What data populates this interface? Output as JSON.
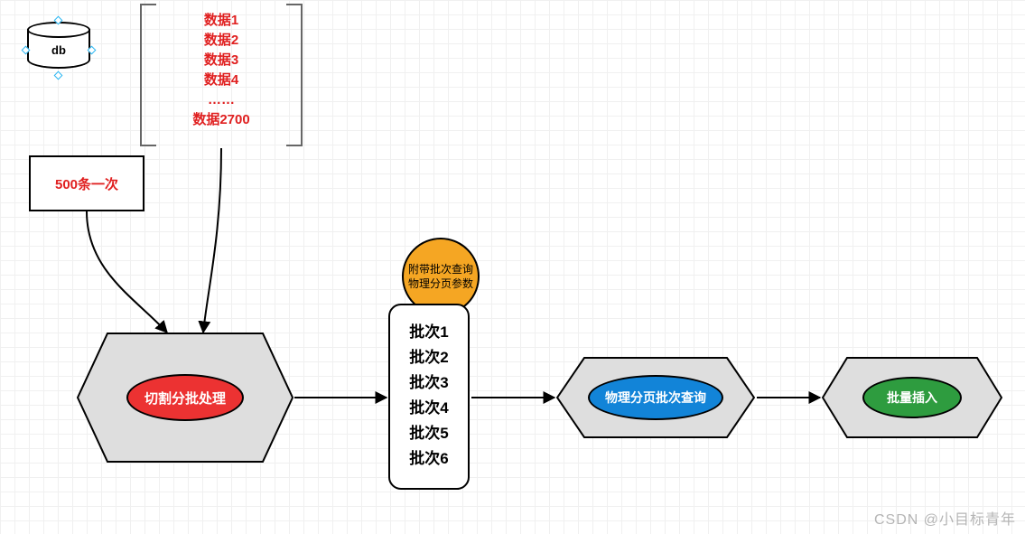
{
  "db": {
    "label": "db"
  },
  "datalist": {
    "items": [
      "数据1",
      "数据2",
      "数据3",
      "数据4",
      "……",
      "数据2700"
    ]
  },
  "box500": {
    "label": "500条一次"
  },
  "hex_split": {
    "label": "切割分批处理"
  },
  "circle_orange": {
    "line1": "附带批次查询",
    "line2": "物理分页参数"
  },
  "batchbox": {
    "items": [
      "批次1",
      "批次2",
      "批次3",
      "批次4",
      "批次5",
      "批次6"
    ]
  },
  "hex_query": {
    "label": "物理分页批次查询"
  },
  "hex_insert": {
    "label": "批量插入"
  },
  "watermark": "CSDN @小目标青年",
  "colors": {
    "red": "#ec3232",
    "blue": "#1284d8",
    "green": "#2e9c3f",
    "orange": "#f5a623",
    "grayfill": "#dedede"
  }
}
